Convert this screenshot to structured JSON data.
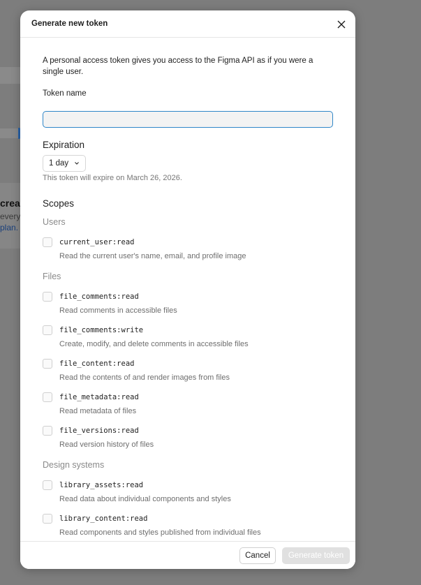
{
  "background": {
    "text_bold": "crea",
    "text_line1": "every",
    "text_link": "plan."
  },
  "dialog": {
    "title": "Generate new token",
    "close_icon": "close-icon",
    "description": "A personal access token gives you access to the Figma API as if you were a single user.",
    "token_name_label": "Token name",
    "token_name_value": "",
    "token_name_placeholder": "",
    "expiration_label": "Expiration",
    "expiration_value": "1 day",
    "expiration_hint": "This token will expire on March 26, 2026.",
    "scopes_label": "Scopes",
    "groups": [
      {
        "label": "Users",
        "scopes": [
          {
            "name": "current_user:read",
            "desc": "Read the current user's name, email, and profile image",
            "checked": false
          }
        ]
      },
      {
        "label": "Files",
        "scopes": [
          {
            "name": "file_comments:read",
            "desc": "Read comments in accessible files",
            "checked": false
          },
          {
            "name": "file_comments:write",
            "desc": "Create, modify, and delete comments in accessible files",
            "checked": false
          },
          {
            "name": "file_content:read",
            "desc": "Read the contents of and render images from files",
            "checked": false
          },
          {
            "name": "file_metadata:read",
            "desc": "Read metadata of files",
            "checked": false
          },
          {
            "name": "file_versions:read",
            "desc": "Read version history of files",
            "checked": false
          }
        ]
      },
      {
        "label": "Design systems",
        "scopes": [
          {
            "name": "library_assets:read",
            "desc": "Read data about individual components and styles",
            "checked": false
          },
          {
            "name": "library_content:read",
            "desc": "Read components and styles published from individual files",
            "checked": false
          }
        ]
      }
    ],
    "cancel_label": "Cancel",
    "generate_label": "Generate token"
  },
  "colors": {
    "overlay": "#7d7d7d",
    "input_focus_border": "#2f86c8",
    "disabled_button": "#e0e0e0"
  }
}
